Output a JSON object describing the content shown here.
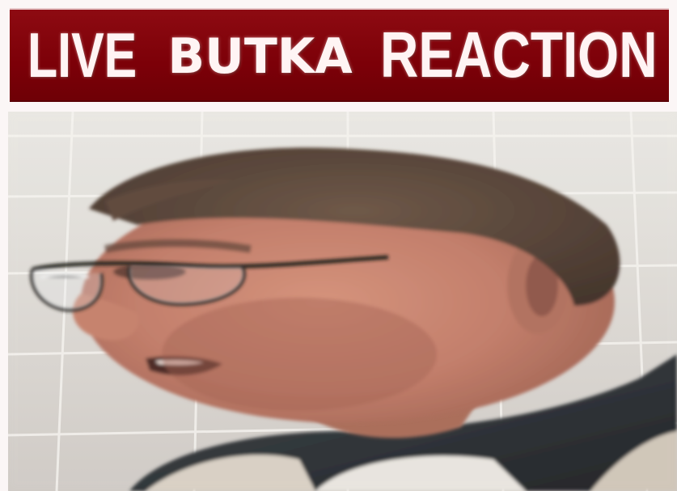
{
  "banner": {
    "word1": "LIVE",
    "word2": "BUTKA",
    "word3": "REACTION"
  },
  "colors": {
    "banner_bg": "#7c0008",
    "banner_text": "#fff4f4",
    "border": "#fbf6f6"
  },
  "photo": {
    "subject": "man-face-photo"
  }
}
